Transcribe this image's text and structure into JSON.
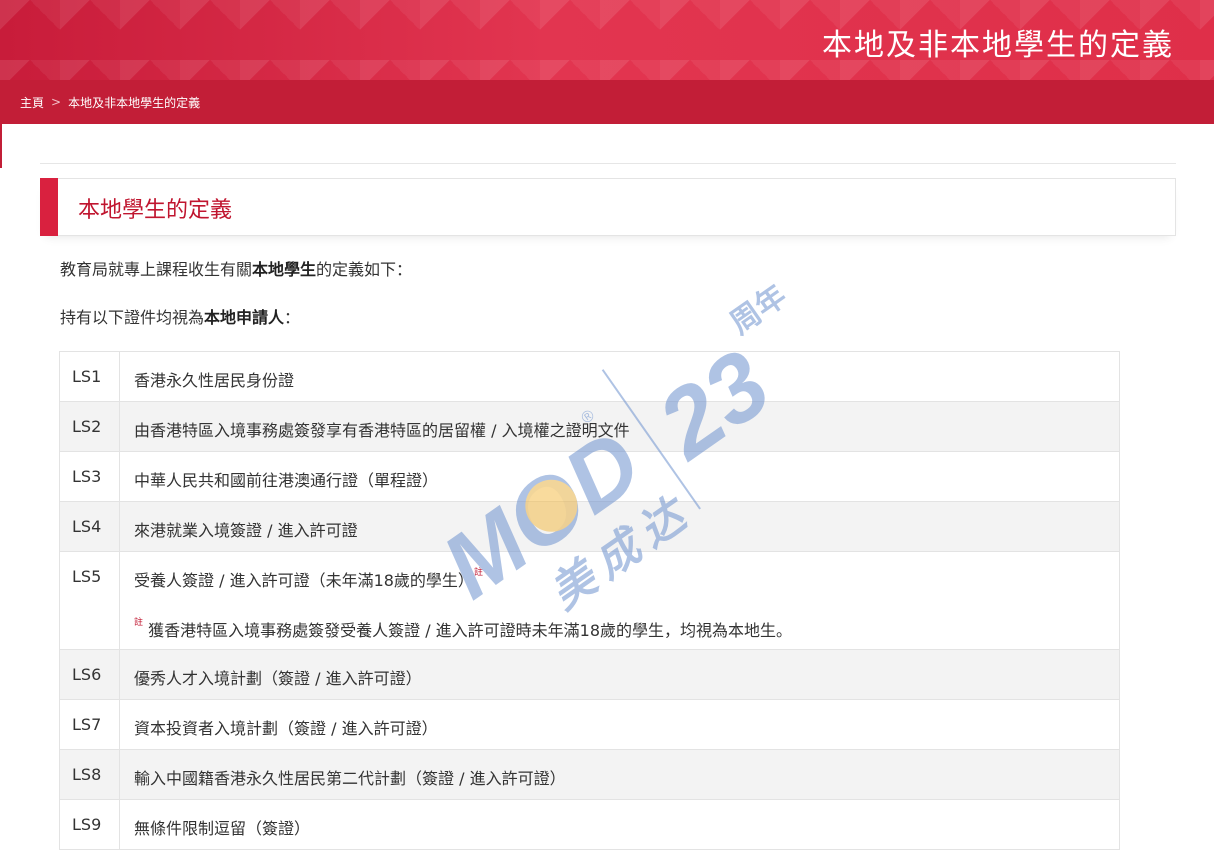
{
  "banner": {
    "title": "本地及非本地學生的定義"
  },
  "breadcrumb": {
    "home": "主頁",
    "separator": ">",
    "current": "本地及非本地學生的定義"
  },
  "section": {
    "title": "本地學生的定義"
  },
  "intro": {
    "line1_pre": "教育局就專上課程收生有關",
    "line1_bold": "本地學生",
    "line1_post": "的定義如下：",
    "line2_pre": "持有以下證件均視為",
    "line2_bold": "本地申請人",
    "line2_post": "："
  },
  "rows": [
    {
      "code": "LS1",
      "text": "香港永久性居民身份證"
    },
    {
      "code": "LS2",
      "text": "由香港特區入境事務處簽發享有香港特區的居留權 / 入境權之證明文件"
    },
    {
      "code": "LS3",
      "text": "中華人民共和國前往港澳通行證（單程證）"
    },
    {
      "code": "LS4",
      "text": "來港就業入境簽證 / 進入許可證"
    },
    {
      "code": "LS5",
      "text": "受養人簽證 / 進入許可證（未年滿18歲的學生）",
      "note_mark": "註",
      "note": "獲香港特區入境事務處簽發受養人簽證 / 進入許可證時未年滿18歲的學生，均視為本地生。"
    },
    {
      "code": "LS6",
      "text": "優秀人才入境計劃（簽證 / 進入許可證）"
    },
    {
      "code": "LS7",
      "text": "資本投資者入境計劃（簽證 / 進入許可證）"
    },
    {
      "code": "LS8",
      "text": "輸入中國籍香港永久性居民第二代計劃（簽證 / 進入許可證）"
    },
    {
      "code": "LS9",
      "text": "無條件限制逗留（簽證）"
    }
  ],
  "watermark": {
    "brand": "MOD",
    "registered": "®",
    "chinese": "美成达",
    "years": "23",
    "years_label": "周年"
  },
  "colors": {
    "brand_red": "#d9213f",
    "breadcrumb_red": "#c21e37",
    "title_red": "#c0152f"
  }
}
